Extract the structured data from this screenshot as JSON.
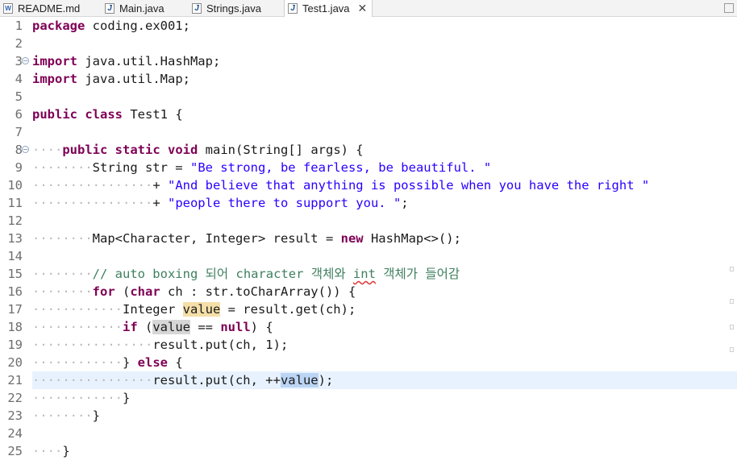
{
  "tabs": [
    {
      "label": "README.md",
      "icon": "markdown-file-icon",
      "active": false
    },
    {
      "label": "Main.java",
      "icon": "java-file-icon",
      "active": false
    },
    {
      "label": "Strings.java",
      "icon": "java-file-icon",
      "active": false
    },
    {
      "label": "Test1.java",
      "icon": "java-file-icon",
      "active": true
    }
  ],
  "icon_glyphs": {
    "markdown": "W",
    "java": "J",
    "close": "✕"
  },
  "lines": [
    {
      "num": "1",
      "text": "package coding.ex001;"
    },
    {
      "num": "2",
      "text": ""
    },
    {
      "num": "3",
      "text": "import java.util.HashMap;",
      "fold": true
    },
    {
      "num": "4",
      "text": "import java.util.Map;"
    },
    {
      "num": "5",
      "text": ""
    },
    {
      "num": "6",
      "text": "public class Test1 {"
    },
    {
      "num": "7",
      "text": ""
    },
    {
      "num": "8",
      "text": "    public static void main(String[] args) {",
      "fold": true
    },
    {
      "num": "9",
      "text": "        String str = \"Be strong, be fearless, be beautiful. \""
    },
    {
      "num": "10",
      "text": "                + \"And believe that anything is possible when you have the right \""
    },
    {
      "num": "11",
      "text": "                + \"people there to support you. \";"
    },
    {
      "num": "12",
      "text": ""
    },
    {
      "num": "13",
      "text": "        Map<Character, Integer> result = new HashMap<>();"
    },
    {
      "num": "14",
      "text": ""
    },
    {
      "num": "15",
      "text": "        // auto boxing 되어 character 객체와 int 객체가 들어감"
    },
    {
      "num": "16",
      "text": "        for (char ch : str.toCharArray()) {"
    },
    {
      "num": "17",
      "text": "            Integer value = result.get(ch);"
    },
    {
      "num": "18",
      "text": "            if (value == null) {"
    },
    {
      "num": "19",
      "text": "                result.put(ch, 1);"
    },
    {
      "num": "20",
      "text": "            } else {"
    },
    {
      "num": "21",
      "text": "                result.put(ch, ++value);",
      "current": true
    },
    {
      "num": "22",
      "text": "            }"
    },
    {
      "num": "23",
      "text": "        }"
    },
    {
      "num": "24",
      "text": ""
    },
    {
      "num": "25",
      "text": "    }"
    }
  ],
  "colors": {
    "keyword": "#7f0055",
    "string": "#2a00ff",
    "comment": "#3f7f5f",
    "line_number": "#6e6e6e",
    "current_line": "#e8f2fe",
    "occurrence_write": "#f5dfa8",
    "occurrence_read": "#d6d6d6",
    "selection": "#bcd5f5"
  }
}
